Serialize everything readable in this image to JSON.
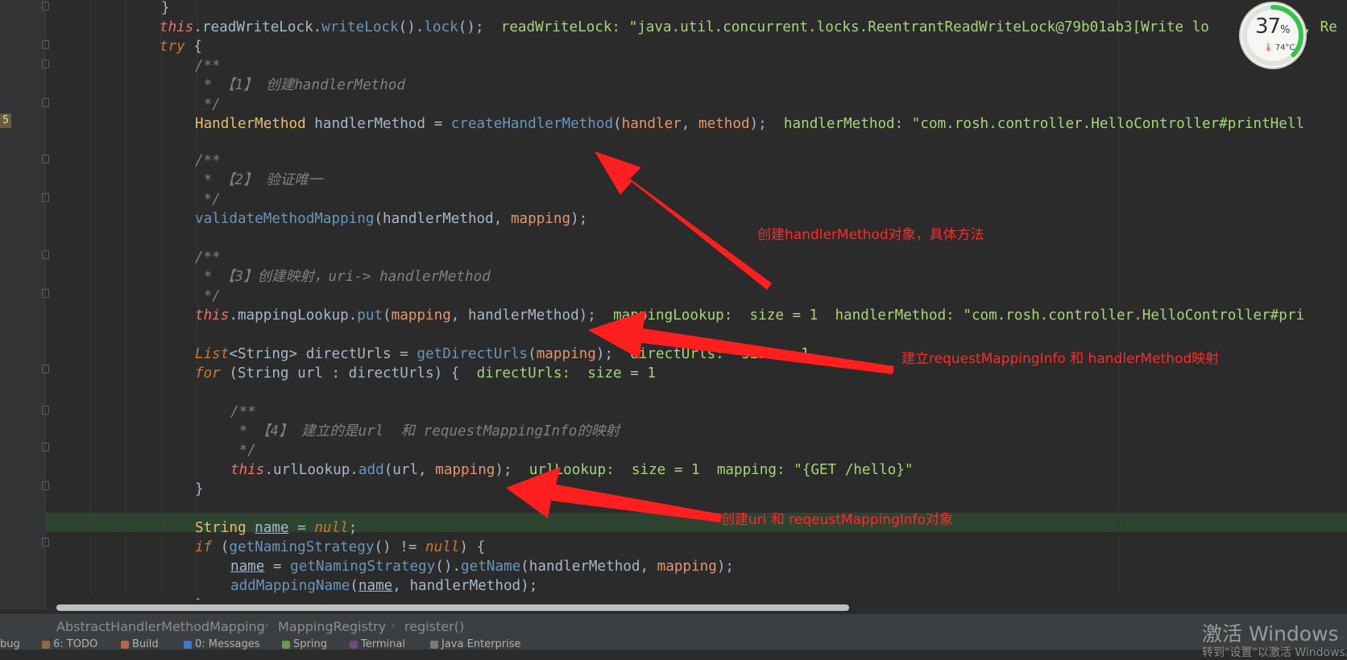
{
  "editor": {
    "gutter_badge": "5",
    "lines": [
      [
        {
          "t": "}",
          "c": ""
        }
      ],
      [
        {
          "t": "this",
          "c": "this"
        },
        {
          "t": ".readWriteLock.",
          "c": ""
        },
        {
          "t": "writeLock",
          "c": "method"
        },
        {
          "t": "().",
          "c": ""
        },
        {
          "t": "lock",
          "c": "method"
        },
        {
          "t": "();  ",
          "c": ""
        },
        {
          "t": "readWriteLock: \"java.util.concurrent.locks.ReentrantReadWriteLock@79b01ab3[Write lo",
          "c": "inline"
        },
        {
          "t": "          ",
          "c": ""
        },
        {
          "t": "1, Re",
          "c": "inline"
        }
      ],
      [
        {
          "t": "try",
          "c": "kwi"
        },
        {
          "t": " {",
          "c": ""
        }
      ],
      [
        {
          "t": "/**",
          "c": "cmt"
        }
      ],
      [
        {
          "t": " * 【1】 创建handlerMethod",
          "c": "cmt"
        }
      ],
      [
        {
          "t": " */",
          "c": "cmt"
        }
      ],
      [
        {
          "t": "HandlerMethod",
          "c": "type"
        },
        {
          "t": " handlerMethod = ",
          "c": ""
        },
        {
          "t": "createHandlerMethod",
          "c": "method"
        },
        {
          "t": "(",
          "c": ""
        },
        {
          "t": "handler",
          "c": "param"
        },
        {
          "t": ", ",
          "c": ""
        },
        {
          "t": "method",
          "c": "param"
        },
        {
          "t": ");  ",
          "c": ""
        },
        {
          "t": "handlerMethod: \"com.rosh.controller.HelloController#printHell",
          "c": "inline"
        }
      ],
      [],
      [
        {
          "t": "/**",
          "c": "cmt"
        }
      ],
      [
        {
          "t": " * 【2】 验证唯一",
          "c": "cmt"
        }
      ],
      [
        {
          "t": " */",
          "c": "cmt"
        }
      ],
      [
        {
          "t": "validateMethodMapping",
          "c": "method"
        },
        {
          "t": "(handlerMethod, ",
          "c": ""
        },
        {
          "t": "mapping",
          "c": "param"
        },
        {
          "t": ");",
          "c": ""
        }
      ],
      [],
      [
        {
          "t": "/**",
          "c": "cmt"
        }
      ],
      [
        {
          "t": " * 【3】创建映射，uri-> handlerMethod",
          "c": "cmt"
        }
      ],
      [
        {
          "t": " */",
          "c": "cmt"
        }
      ],
      [
        {
          "t": "this",
          "c": "this"
        },
        {
          "t": ".mappingLookup.",
          "c": ""
        },
        {
          "t": "put",
          "c": "method"
        },
        {
          "t": "(",
          "c": ""
        },
        {
          "t": "mapping",
          "c": "param"
        },
        {
          "t": ", handlerMethod);  ",
          "c": ""
        },
        {
          "t": "mappingLookup:  size = 1  handlerMethod: \"com.rosh.controller.HelloController#pri",
          "c": "inline"
        }
      ],
      [],
      [
        {
          "t": "List",
          "c": "kwi"
        },
        {
          "t": "<String> directUrls = ",
          "c": ""
        },
        {
          "t": "getDirectUrls",
          "c": "method"
        },
        {
          "t": "(",
          "c": ""
        },
        {
          "t": "mapping",
          "c": "param"
        },
        {
          "t": ");  ",
          "c": ""
        },
        {
          "t": "directUrls:  size = 1",
          "c": "inline"
        }
      ],
      [
        {
          "t": "for",
          "c": "kwi"
        },
        {
          "t": " (String url : directUrls) {  ",
          "c": ""
        },
        {
          "t": "directUrls:  size = 1",
          "c": "inline"
        }
      ],
      [],
      [
        {
          "t": "/**",
          "c": "cmt"
        }
      ],
      [
        {
          "t": " * 【4】 建立的是url  和 requestMappingInfo的映射",
          "c": "cmt"
        }
      ],
      [
        {
          "t": " */",
          "c": "cmt"
        }
      ],
      [
        {
          "t": "this",
          "c": "this"
        },
        {
          "t": ".urlLookup.",
          "c": ""
        },
        {
          "t": "add",
          "c": "method"
        },
        {
          "t": "(url, ",
          "c": ""
        },
        {
          "t": "mapping",
          "c": "param"
        },
        {
          "t": ");  ",
          "c": ""
        },
        {
          "t": "urlLookup:  size = 1  mapping: \"{GET /hello}\"",
          "c": "inline"
        }
      ],
      [
        {
          "t": "}",
          "c": ""
        }
      ],
      [],
      [
        {
          "t": "String",
          "c": "type"
        },
        {
          "t": " ",
          "c": ""
        },
        {
          "t": "name",
          "c": "u"
        },
        {
          "t": " = ",
          "c": ""
        },
        {
          "t": "null",
          "c": "kwi"
        },
        {
          "t": ";",
          "c": ""
        }
      ],
      [
        {
          "t": "if",
          "c": "kwi"
        },
        {
          "t": " (",
          "c": ""
        },
        {
          "t": "getNamingStrategy",
          "c": "method"
        },
        {
          "t": "() != ",
          "c": ""
        },
        {
          "t": "null",
          "c": "kwi"
        },
        {
          "t": ") {",
          "c": ""
        }
      ],
      [
        {
          "t": "name",
          "c": "u"
        },
        {
          "t": " = ",
          "c": ""
        },
        {
          "t": "getNamingStrategy",
          "c": "method"
        },
        {
          "t": "().",
          "c": ""
        },
        {
          "t": "getName",
          "c": "method"
        },
        {
          "t": "(handlerMethod, ",
          "c": ""
        },
        {
          "t": "mapping",
          "c": "param"
        },
        {
          "t": ");",
          "c": ""
        }
      ],
      [
        {
          "t": "addMappingName",
          "c": "method"
        },
        {
          "t": "(",
          "c": ""
        },
        {
          "t": "name",
          "c": "u"
        },
        {
          "t": ", handlerMethod);",
          "c": ""
        }
      ],
      [
        {
          "t": "}",
          "c": ""
        }
      ]
    ]
  },
  "annotations": {
    "a1": "创建handlerMethod对象，具体方法",
    "a2": "建立requestMappingInfo 和 handlerMethod映射",
    "a3": "创建uri 和 reqeustMappingInfo对象"
  },
  "colors": {
    "annotation": "#ff2a2a",
    "current_line": "#2e4330"
  },
  "gauge": {
    "value": "37",
    "unit": "%",
    "temp": "74°C",
    "temp_icon": "thermometer-icon",
    "percent": 0.37
  },
  "breadcrumb": [
    "AbstractHandlerMethodMapping",
    "MappingRegistry",
    "register()"
  ],
  "tool_windows": [
    {
      "label": "bug",
      "icon": "debug-icon"
    },
    {
      "label": "6: TODO",
      "icon": "todo-icon"
    },
    {
      "label": "Build",
      "icon": "build-icon"
    },
    {
      "label": "0: Messages",
      "icon": "messages-icon"
    },
    {
      "label": "Spring",
      "icon": "spring-icon"
    },
    {
      "label": "Terminal",
      "icon": "terminal-icon"
    },
    {
      "label": "Java Enterprise",
      "icon": "java-enterprise-icon"
    }
  ],
  "watermark": {
    "title": "激活 Windows",
    "subtitle": "转到\"设置\"以激活 Windows。"
  }
}
